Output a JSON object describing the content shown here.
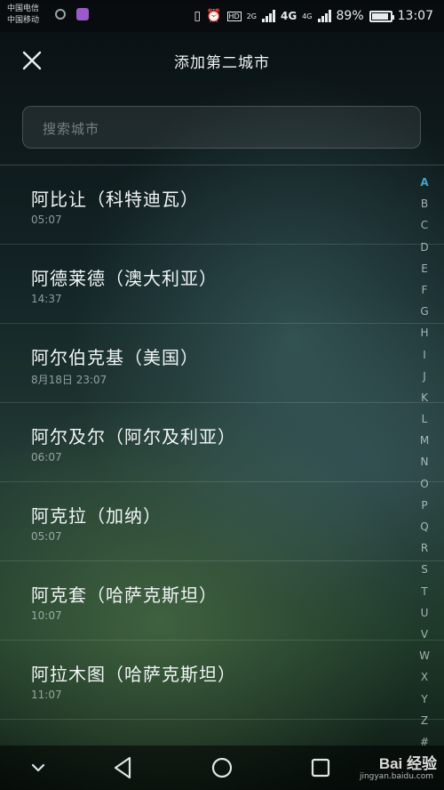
{
  "status_bar": {
    "carrier1": "中国电信",
    "carrier2": "中国移动",
    "network_small": "2G",
    "network_4g": "4G",
    "network_4g_small": "4G",
    "battery_text": "89%",
    "battery_level": 0.89,
    "time": "13:07"
  },
  "header": {
    "title": "添加第二城市",
    "close_icon": "close-icon"
  },
  "search": {
    "placeholder": "搜索城市",
    "value": ""
  },
  "cities": [
    {
      "name": "阿比让（科特迪瓦）",
      "time": "05:07"
    },
    {
      "name": "阿德莱德（澳大利亚）",
      "time": "14:37"
    },
    {
      "name": "阿尔伯克基（美国）",
      "time": "8月18日  23:07"
    },
    {
      "name": "阿尔及尔（阿尔及利亚）",
      "time": "06:07"
    },
    {
      "name": "阿克拉（加纳）",
      "time": "05:07"
    },
    {
      "name": "阿克套（哈萨克斯坦）",
      "time": "10:07"
    },
    {
      "name": "阿拉木图（哈萨克斯坦）",
      "time": "11:07"
    }
  ],
  "index_letters": [
    "A",
    "B",
    "C",
    "D",
    "E",
    "F",
    "G",
    "H",
    "I",
    "J",
    "K",
    "L",
    "M",
    "N",
    "O",
    "P",
    "Q",
    "R",
    "S",
    "T",
    "U",
    "V",
    "W",
    "X",
    "Y",
    "Z",
    "#"
  ],
  "active_letter": "A",
  "colors": {
    "accent": "#46a3c8"
  },
  "watermark": {
    "main": "Bai 经验",
    "sub": "jingyan.baidu.com"
  }
}
